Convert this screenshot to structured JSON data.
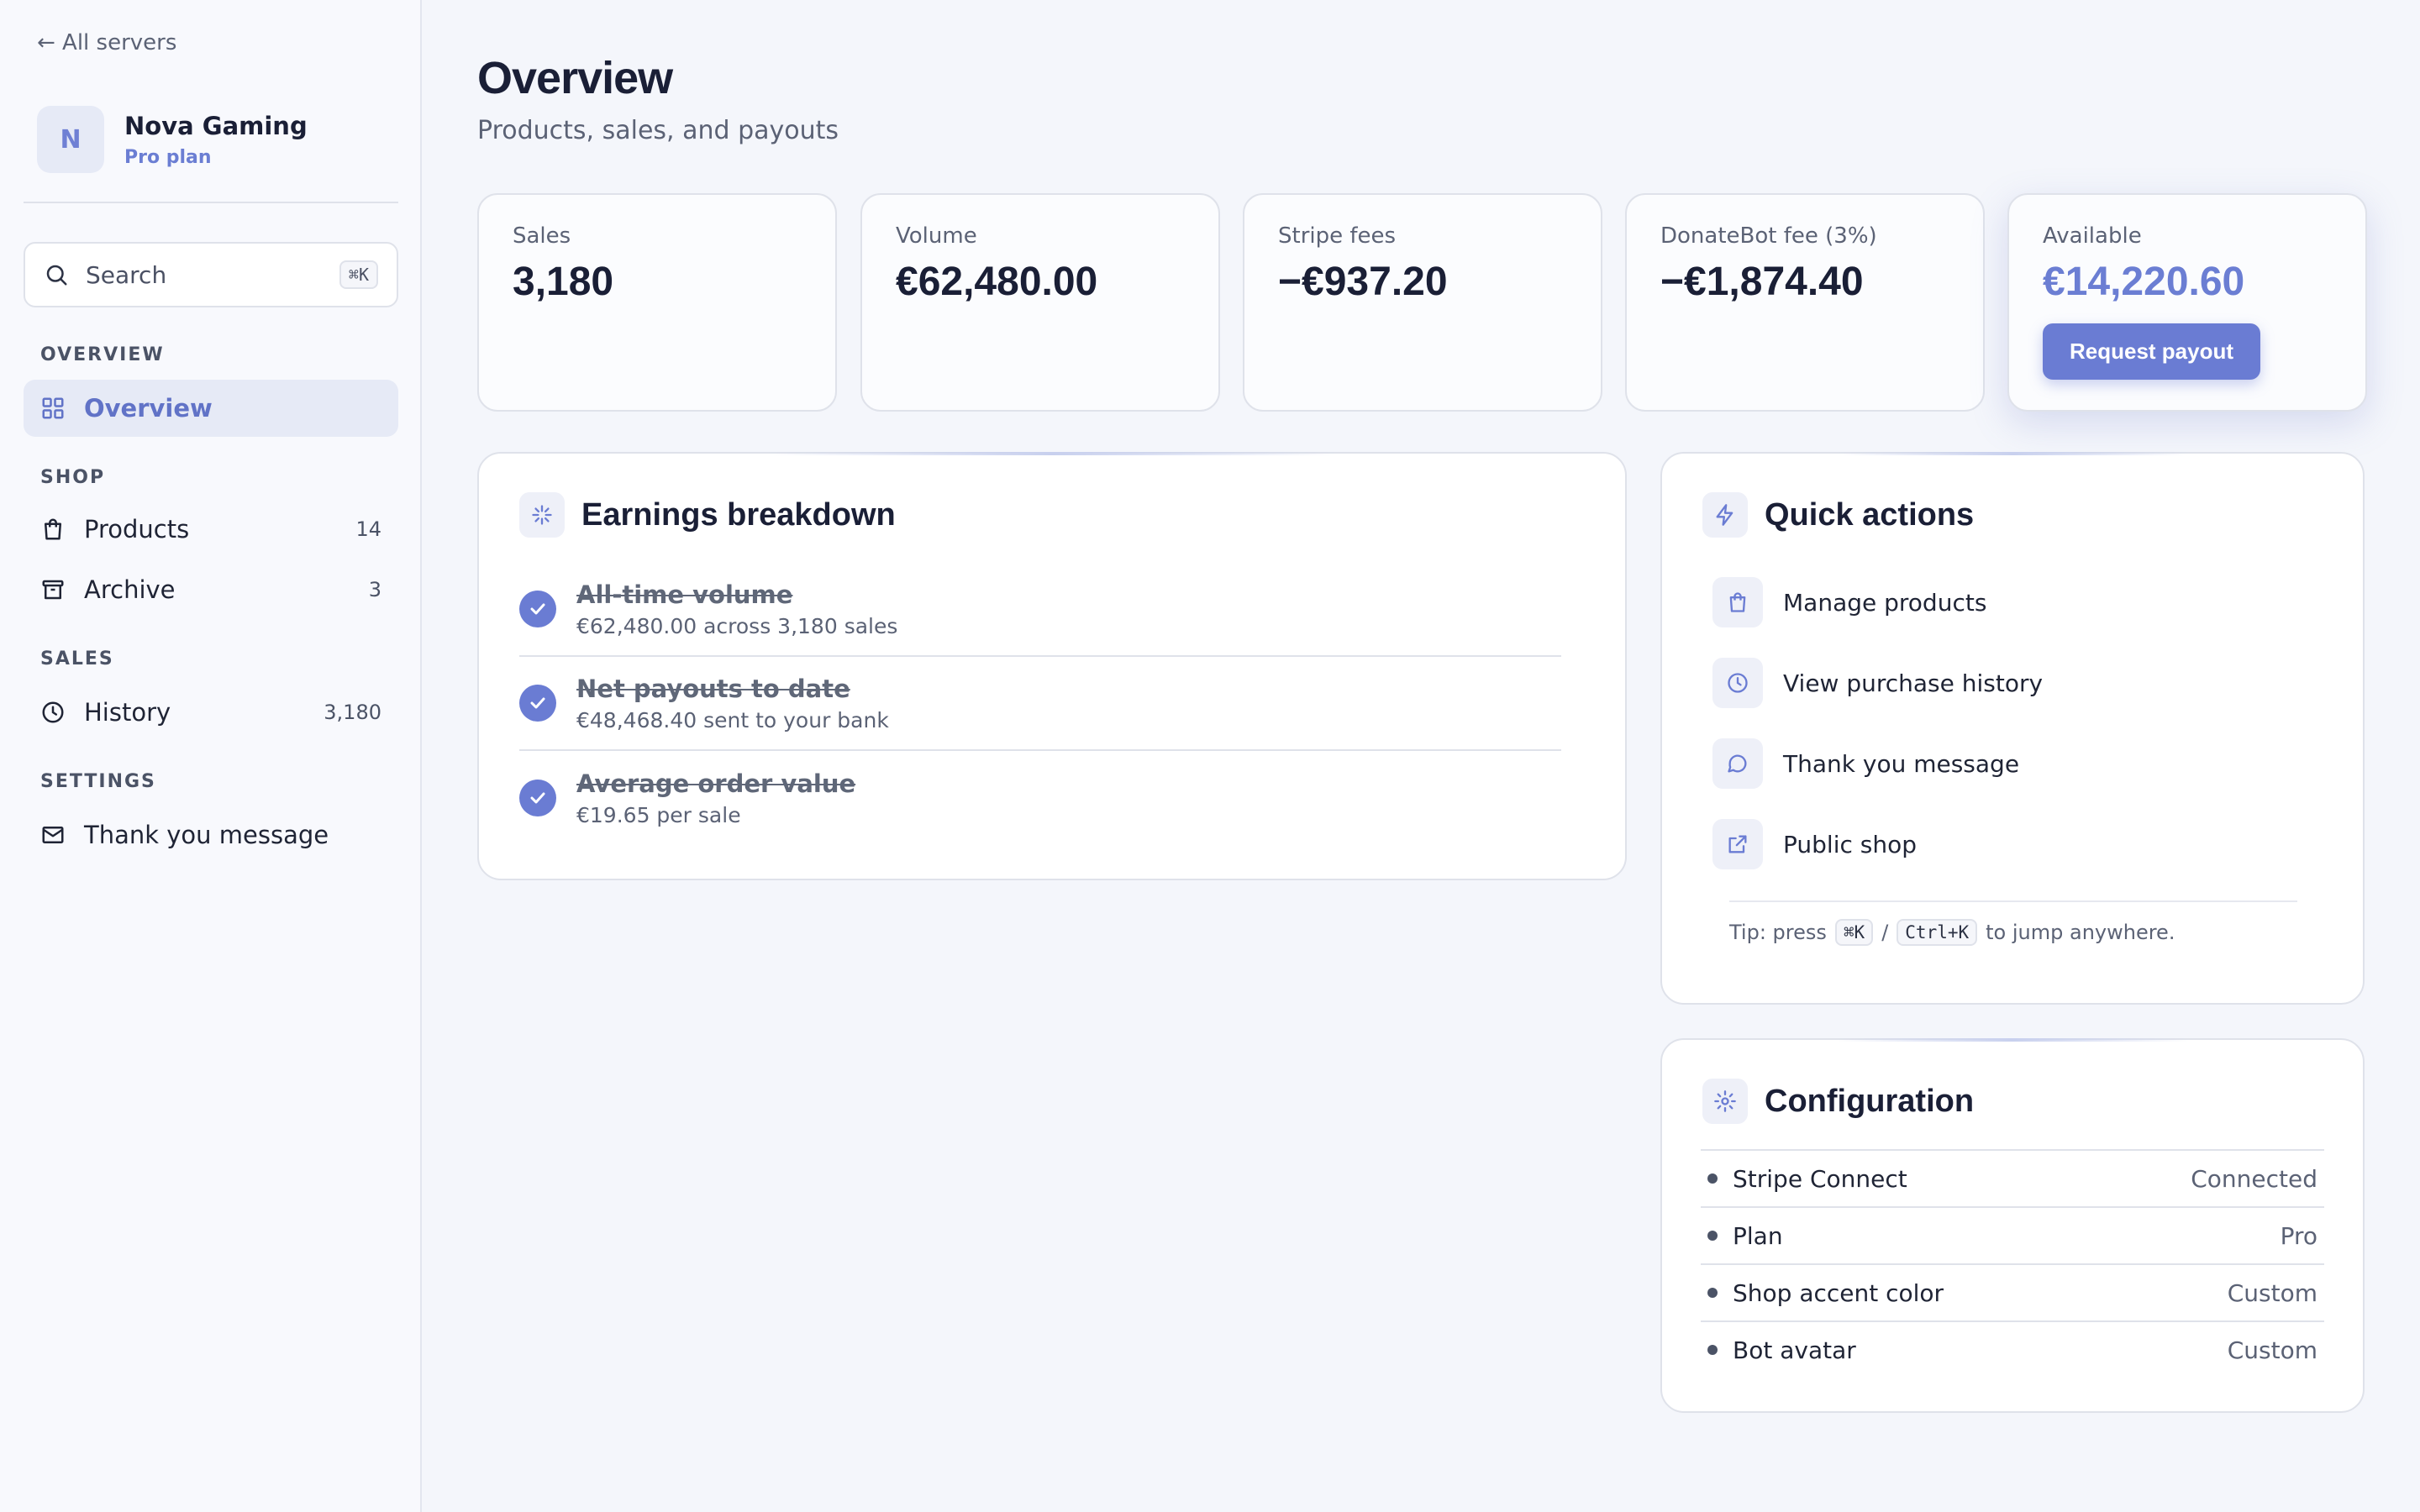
{
  "colors": {
    "accent": "#6a7cd3",
    "accent_text": "#6b7ed3",
    "text": "#1a1f36",
    "muted": "#5b6275",
    "border": "#dfe2ea",
    "background": "#f4f6fb"
  },
  "sidebar": {
    "back_link": "← All servers",
    "server": {
      "initial": "N",
      "name": "Nova Gaming",
      "plan": "Pro plan"
    },
    "search": {
      "placeholder": "Search",
      "shortcut": "⌘K",
      "icon": "search-icon"
    },
    "sections": [
      {
        "heading": "OVERVIEW",
        "items": [
          {
            "label": "Overview",
            "icon": "grid-icon",
            "active": true
          }
        ]
      },
      {
        "heading": "SHOP",
        "items": [
          {
            "label": "Products",
            "icon": "shopping-bag-icon",
            "count": "14"
          },
          {
            "label": "Archive",
            "icon": "archive-icon",
            "count": "3"
          }
        ]
      },
      {
        "heading": "SALES",
        "items": [
          {
            "label": "History",
            "icon": "clock-icon",
            "count": "3,180"
          }
        ]
      },
      {
        "heading": "SETTINGS",
        "items": [
          {
            "label": "Thank you message",
            "icon": "mail-icon"
          }
        ]
      }
    ]
  },
  "header": {
    "title": "Overview",
    "subtitle": "Products, sales, and payouts"
  },
  "stats": [
    {
      "label": "Sales",
      "value": "3,180"
    },
    {
      "label": "Volume",
      "value": "€62,480.00"
    },
    {
      "label": "Stripe fees",
      "value": "−€937.20"
    },
    {
      "label": "DonateBot fee (3%)",
      "value": "−€1,874.40"
    },
    {
      "label": "Available",
      "value": "€14,220.60",
      "button": "Request payout"
    }
  ],
  "earnings": {
    "title": "Earnings breakdown",
    "icon": "sparkle-icon",
    "rows": [
      {
        "title": "All-time volume",
        "subtitle": "€62,480.00 across 3,180 sales",
        "done": true
      },
      {
        "title": "Net payouts to date",
        "subtitle": "€48,468.40 sent to your bank",
        "done": true
      },
      {
        "title": "Average order value",
        "subtitle": "€19.65 per sale",
        "done": true
      }
    ]
  },
  "quick_actions": {
    "title": "Quick actions",
    "icon": "lightning-icon",
    "items": [
      {
        "label": "Manage products",
        "icon": "shopping-bag-icon"
      },
      {
        "label": "View purchase history",
        "icon": "clock-icon"
      },
      {
        "label": "Thank you message",
        "icon": "chat-bubble-icon"
      },
      {
        "label": "Public shop",
        "icon": "external-link-icon"
      }
    ],
    "tip": {
      "prefix": "Tip: press",
      "key1": "⌘K",
      "separator": "/",
      "key2": "Ctrl+K",
      "suffix": "to jump anywhere."
    }
  },
  "configuration": {
    "title": "Configuration",
    "icon": "gear-icon",
    "rows": [
      {
        "label": "Stripe Connect",
        "value": "Connected"
      },
      {
        "label": "Plan",
        "value": "Pro"
      },
      {
        "label": "Shop accent color",
        "value": "Custom"
      },
      {
        "label": "Bot avatar",
        "value": "Custom"
      }
    ]
  }
}
